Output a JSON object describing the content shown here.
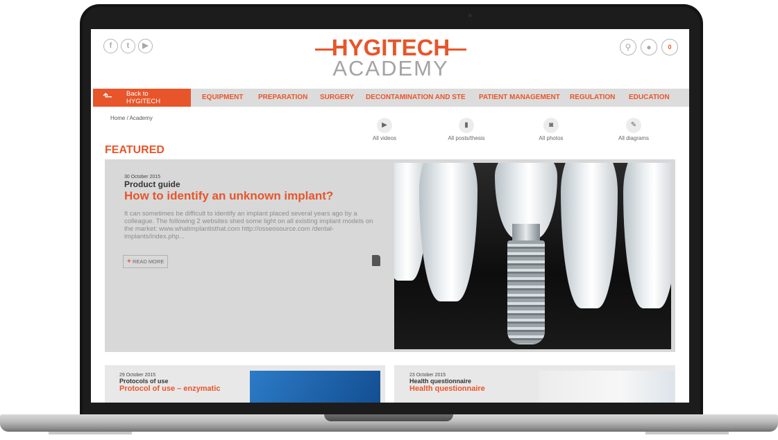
{
  "social": [
    {
      "icon": "facebook-icon",
      "glyph": "f"
    },
    {
      "icon": "twitter-icon",
      "glyph": "t"
    },
    {
      "icon": "youtube-icon",
      "glyph": "▶"
    }
  ],
  "tools": [
    {
      "icon": "search-icon",
      "glyph": "⚲"
    },
    {
      "icon": "user-icon",
      "glyph": "●"
    },
    {
      "icon": "cart-icon",
      "glyph": "0"
    }
  ],
  "logo": {
    "top": "HYGITECH",
    "bottom": "ACADEMY"
  },
  "nav": {
    "back": "Back to HYGITECH",
    "items": [
      "EQUIPMENT",
      "PREPARATION",
      "SURGERY",
      "DECONTAMINATION AND STE",
      "PATIENT MANAGEMENT",
      "REGULATION",
      "EDUCATION"
    ]
  },
  "breadcrumb": "Home / Academy",
  "quick_links": [
    {
      "label": "All videos",
      "icon": "video-icon",
      "glyph": "▶"
    },
    {
      "label": "All posts/thesis",
      "icon": "document-icon",
      "glyph": "▮"
    },
    {
      "label": "All photos",
      "icon": "camera-icon",
      "glyph": "◙"
    },
    {
      "label": "All diagrams",
      "icon": "edit-icon",
      "glyph": "✎"
    }
  ],
  "featured_heading": "FEATURED",
  "featured": {
    "date": "30 October 2015",
    "category": "Product guide",
    "title": "How to identify an unknown implant?",
    "excerpt": "It can sometimes be difficult to identify an implant placed several years ago by a colleague. The following 2 websites shed some light on all existing implant models on the market: www.whatimplantisthat.com http://osseosource.com /dental-implants/index.php...",
    "read_more": "READ MORE"
  },
  "cards": [
    {
      "date": "29 October 2015",
      "category": "Protocols of use",
      "title": "Protocol of use – enzymatic"
    },
    {
      "date": "23 October 2015",
      "category": "Health questionnaire",
      "title": "Health questionnaire"
    }
  ],
  "colors": {
    "accent": "#e8552a",
    "nav_bg": "#dcdcdc",
    "card_bg": "#d8d8d8"
  }
}
